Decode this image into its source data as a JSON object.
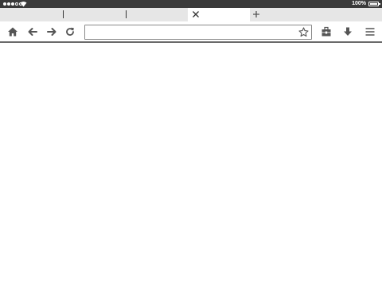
{
  "status_bar": {
    "battery_text": "100%",
    "battery_level": 1.0
  },
  "tabs": [
    {
      "title": "",
      "active": false
    },
    {
      "title": "",
      "active": false
    },
    {
      "title": "",
      "active": false
    },
    {
      "title": "",
      "active": true,
      "close_icon": "close-icon"
    }
  ],
  "toolbar": {
    "icons": [
      "home-icon",
      "back-arrow-icon",
      "forward-arrow-icon",
      "reload-icon",
      "toolbox-icon",
      "download-icon",
      "menu-icon"
    ]
  },
  "url_bar": {
    "value": "",
    "placeholder": "",
    "bookmark_icon": "star-outline-icon"
  },
  "colors": {
    "status_bar": "#3a3a3a",
    "tab_strip": "#e6e6e6",
    "icon": "#555555",
    "toolbar_border": "#6a6a6a"
  }
}
